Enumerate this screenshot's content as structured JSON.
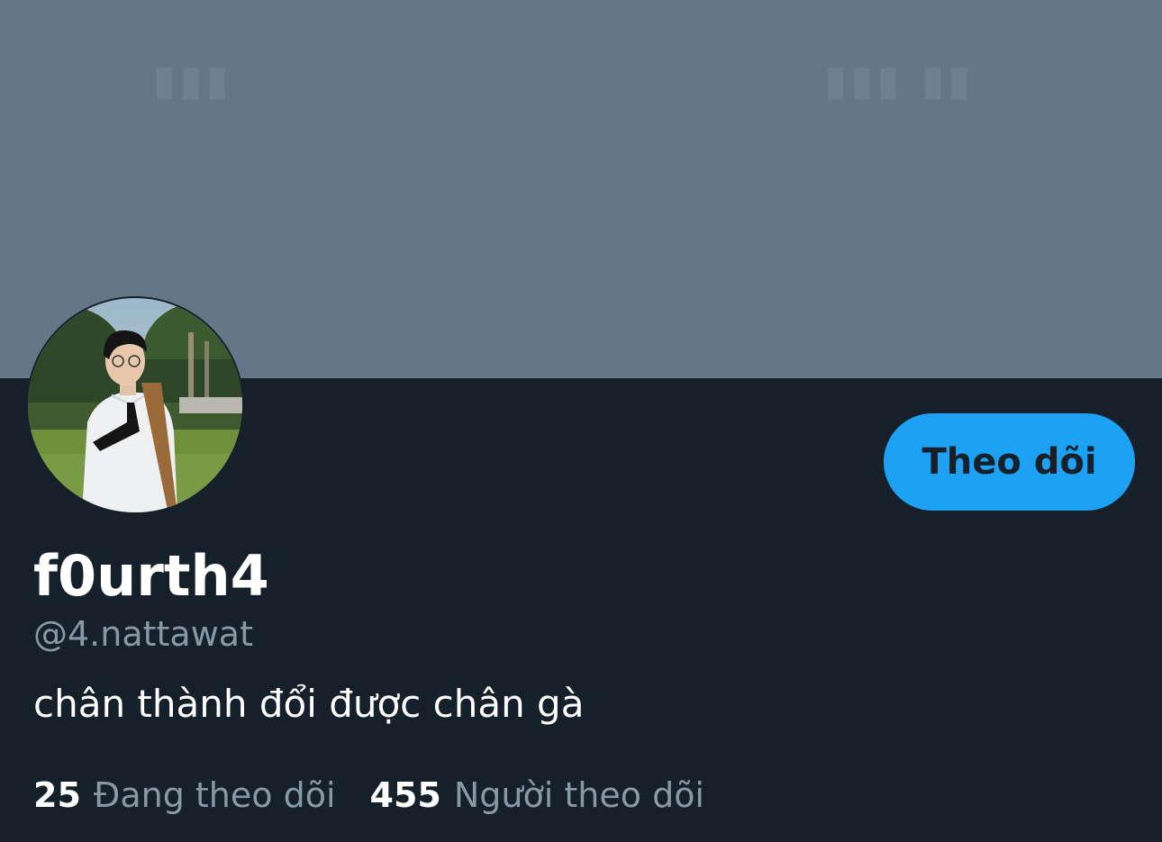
{
  "colors": {
    "background": "#15202b",
    "banner": "#657786",
    "accent": "#1da1f2",
    "secondary_text": "#8899a6",
    "primary_text": "#ffffff"
  },
  "profile": {
    "display_name": "f0urth4",
    "handle": "@4.nattawat",
    "bio": "chân thành đổi được chân gà",
    "follow_button_label": "Theo dõi",
    "avatar_icon": "profile-photo"
  },
  "stats": {
    "following_count": "25",
    "following_label": "Đang theo dõi",
    "followers_count": "455",
    "followers_label": "Người theo dõi"
  }
}
